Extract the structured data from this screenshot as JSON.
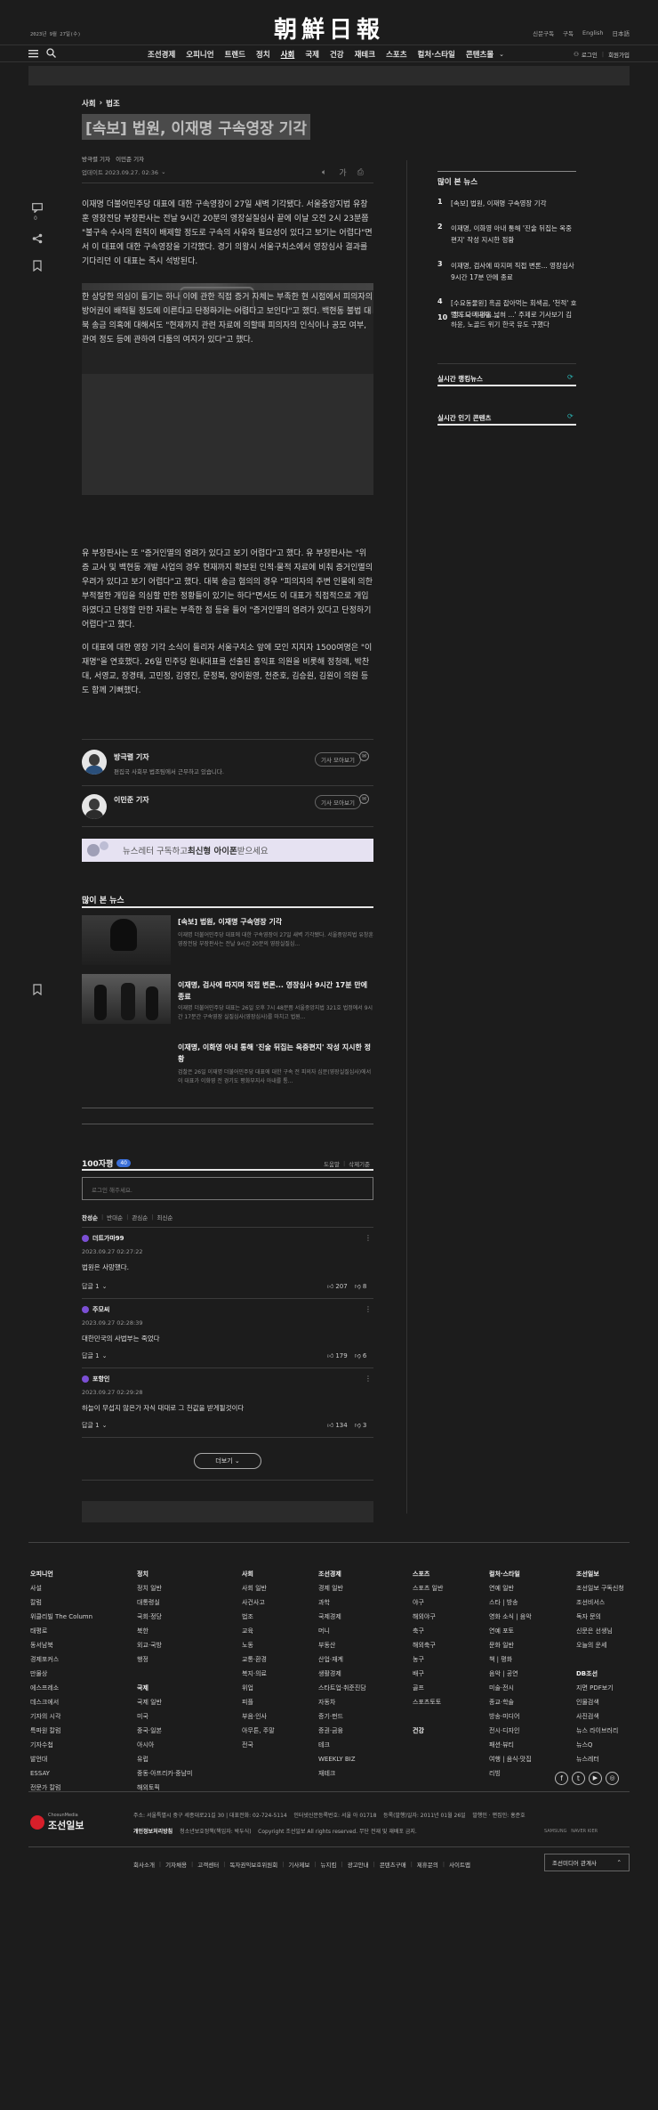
{
  "header": {
    "date": "2023년 9월 27일(수)",
    "logo": "朝鮮日報",
    "util": [
      "신문구독",
      "구독",
      "English",
      "日本語"
    ],
    "nav": [
      "조선경제",
      "오피니언",
      "트렌드",
      "정치",
      "사회",
      "국제",
      "건강",
      "재테크",
      "스포츠",
      "컬처·스타일",
      "콘텐츠몰"
    ],
    "login": "로그인",
    "signup": "회원가입"
  },
  "article": {
    "breadcrumb": [
      "사회",
      "법조"
    ],
    "title": "[속보] 법원, 이재명 구속영장 기각",
    "reporters": "방극렬 기자   이민준 기자",
    "updated": "업데이트 2023.09.27. 02:36",
    "paragraphs": [
      "이재명 더불어민주당 대표에 대한 구속영장이 27일 새벽 기각됐다. 서울중앙지법 유창훈 영장전담 부장판사는 전날 9시간 20분의 영장실질심사 끝에 이날 오전 2시 23분쯤 \"불구속 수사의 원칙이 배제할 정도로 구속의 사유와 필요성이 있다고 보기는 어렵다\"면서 이 대표에 대한 구속영장을 기각했다. 경기 의왕시 서울구치소에서 영장심사 결과를 기다리던 이 대표는 즉시 석방된다.",
      "한 상당한 의심이 들기는 하나 이에 관한 직접 증거 자체는 부족한 현 시점에서 피의자의 방어권이 배척될 정도에 이른다고 단정하기는 어렵다고 보인다\"고 했다. 백현동 불법 대북 송금 의혹에 대해서도 \"현재까지 관련 자료에 의할때 피의자의 인식이나 공모 여부, 관여 정도 등에 관하여 다툼의 여지가 있다\"고 했다.",
      "유 부장판사는 또 \"증거인멸의 염려가 있다고 보기 어렵다\"고 했다. 유 부장판사는 \"위증 교사 및 백현동 개발 사업의 경우 현재까지 확보된 인적·물적 자료에 비춰 증거인멸의 우려가 있다고 보기 어렵다\"고 했다. 대북 송금 혐의의 경우 \"피의자의 주변 인물에 의한 부적절한 개입을 의심할 만한 정황들이 있기는 하다\"면서도 이 대표가 직접적으로 개입하였다고 단정할 만한 자료는 부족한 점 등을 들어 \"증거인멸의 염려가 있다고 단정하기 어렵다\"고 했다.",
      "이 대표에 대한 영장 기각 소식이 들리자 서울구치소 앞에 모인 지지자 1500여명은 \"이재명\"을 연호했다. 26일 민주당 원내대표를 선출된 홍익표 의원을 비롯해 정청래, 박찬대, 서영교, 장경태, 고민정, 김영진, 문정복, 양이원영, 천준호, 김승원, 김원이 의원 등도 함께 기뻐했다."
    ],
    "share_count": "0",
    "font_btn": "가"
  },
  "authors": [
    {
      "name": "방극렬 기자",
      "desc": "편집국 사회부 법조팀에서 근무하고 있습니다.",
      "more": "기사 모아보기"
    },
    {
      "name": "이민준 기자",
      "desc": "",
      "more": "기사 모아보기"
    }
  ],
  "banner": {
    "text_a": "뉴스레터 구독하고 ",
    "text_b": "최신형 아이폰",
    "text_c": " 받으세요"
  },
  "popular_section": {
    "title": "많이 본 뉴스",
    "items": [
      {
        "title": "[속보] 법원, 이재명 구속영장 기각",
        "desc": "이재명 더불어민주당 대표에 대한 구속영장이 27일 새벽 기각됐다. 서울중앙지법 유창훈 영장전담 부장판사는 전날 9시간 20분의 영장실질심..."
      },
      {
        "title": "이재명, 검사에 따지며 직접 변론... 영장심사 9시간 17분 만에 종료",
        "desc": "이재명 더불어민주당 대표는 26일 오후 7시 48분쯤 서울중앙지법 321호 법정에서 9시간 17분간 구속영장 실질심사(영장심사)를 마치고 법원..."
      },
      {
        "title": "이재명, 이화영 아내 통해 '진술 뒤집는 옥중편지' 작성 지시한 정황",
        "desc": "검찰은 26일 이재명 더불어민주당 대표에 대한 구속 전 피의자 심문(영장실질심사)에서 이 대표가 이화영 전 경기도 평화부지사 아내를 통..."
      }
    ]
  },
  "comments": {
    "title": "100자평",
    "count": "40",
    "guide": "도움말",
    "rule": "삭제기준",
    "placeholder": "로그인 해주세요.",
    "sort": [
      "찬성순",
      "반대순",
      "관심순",
      "최신순"
    ],
    "list": [
      {
        "user": "더트가마99",
        "date": "2023.09.27 02:27:22",
        "text": "법원은 사망했다.",
        "reply": "답글 1",
        "up": "207",
        "down": "8"
      },
      {
        "user": "주모씨",
        "date": "2023.09.27 02:28:39",
        "text": "대한민국의 사법부는 죽었다",
        "reply": "답글 1",
        "up": "179",
        "down": "6"
      },
      {
        "user": "포항인",
        "date": "2023.09.27 02:29:28",
        "text": "하늘이 무섭지 않은가 자식 대대로 그 천값을 받게될것이다",
        "reply": "답글 1",
        "up": "134",
        "down": "3"
      }
    ],
    "more": "더보기"
  },
  "sidebar": {
    "most_read_title": "많이 본 뉴스",
    "most_read": [
      {
        "rank": "1",
        "title": "[속보] 법원, 이재명 구속영장 기각"
      },
      {
        "rank": "2",
        "title": "이재명, 이화영 아내 통해 '진술 뒤집는 옥중편지' 작성 지시한 정황"
      },
      {
        "rank": "3",
        "title": "이재명, 검사에 따지며 직접 변론... 영장심사 9시간 17분 만에 종료"
      },
      {
        "rank": "4",
        "title": "[수요동물원] 흑곰 잡아먹는 회색곰, '천적' 호랑이 나타나자..."
      },
      {
        "rank": "10",
        "title": "'정도도 지평을 넓혀 ...' 주제로 기사보기 김하윤, 노골드 위기 한국 유도 구했다"
      }
    ],
    "realtime_title": "실시간 랭킹뉴스",
    "popular_title": "실시간 인기 콘텐츠"
  },
  "footer": {
    "cols": [
      {
        "head": "오피니언",
        "items": [
          "사설",
          "칼럼",
          "위클리빌 The Column",
          "태평로",
          "동서남북",
          "경제포커스",
          "만물상",
          "에스프레소",
          "데스크에서",
          "기자의 시각",
          "특파원 칼럼",
          "기자수첩",
          "발언대",
          "ESSAY",
          "전문가 칼럼"
        ]
      },
      {
        "head": "정치",
        "items": [
          "정치 일반",
          "대통령실",
          "국회·정당",
          "북한",
          "외교·국방",
          "행정",
          "",
          "국제",
          "국제 일반",
          "미국",
          "중국·일본",
          "아시아",
          "유럽",
          "중동·아프리카·중남미",
          "해외토픽"
        ]
      },
      {
        "head": "사회",
        "items": [
          "사회 일반",
          "사건사고",
          "법조",
          "교육",
          "노동",
          "교통·환경",
          "복지·의료",
          "위업",
          "피플",
          "부음·인사",
          "아무튼, 주말",
          "전국"
        ]
      },
      {
        "head": "조선경제",
        "items": [
          "경제 일반",
          "과학",
          "국제경제",
          "머니",
          "부동산",
          "산업·재계",
          "생활경제",
          "스타트업·취준진담",
          "자동차",
          "증기·펀드",
          "증권·금융",
          "테크",
          "WEEKLY BIZ",
          "재테크"
        ]
      },
      {
        "head": "스포츠",
        "items": [
          "스포츠 일반",
          "야구",
          "해외야구",
          "축구",
          "해외축구",
          "농구",
          "배구",
          "골프",
          "스포츠토토",
          "",
          "건강"
        ]
      },
      {
        "head": "컬처·스타일",
        "items": [
          "연예 일반",
          "스타 | 방송",
          "영화 소식 | 음악",
          "연예 포토",
          "문화 일반",
          "책 | 평화",
          "음악 | 공연",
          "미술·전시",
          "종교·학술",
          "방송·미디어",
          "전시·디자인",
          "패션·뷰티",
          "여행 | 음식·맛집",
          "리빙"
        ]
      },
      {
        "head": "조선일보",
        "items": [
          "조선일보 구독신청",
          "조선비서스",
          "독자 문의",
          "신문은 선생님",
          "오늘의 운세",
          "",
          "DB조선",
          "지면 PDF보기",
          "인물검색",
          "사진검색",
          "뉴스 라이브러리",
          "뉴스Q",
          "뉴스레터"
        ]
      }
    ],
    "brand_en": "ChosunMedia",
    "brand": "조선일보",
    "info1": "주소: 서울특별시 중구 세종대로21길 30 | 대표전화: 02-724-5114    인터넷신문등록번호: 서울 아 01718    등록(발행)일자: 2011년 01월 26일    발행인 · 편집인: 홍준호",
    "info2a": "개인정보처리방침",
    "info2b": "청소년보호정책(책임자: 박두식)    Copyright 조선일보 All rights reserved. 무단 전재 및 재배포 금지.",
    "links": [
      "회사소개",
      "기자채용",
      "고객센터",
      "독자권익보호위원회",
      "기사제보",
      "뉴지킴",
      "광고안내",
      "콘텐츠구매",
      "제휴문의",
      "사이트맵"
    ],
    "family": "조선미디어 관계사",
    "badges": "SAMSUNG   NAVER KIER"
  }
}
